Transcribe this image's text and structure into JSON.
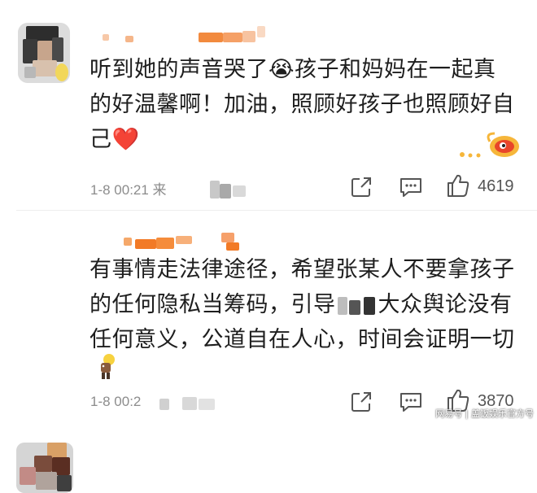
{
  "comments": [
    {
      "lines": [
        "听到她的声音哭了😭孩子和妈妈在一起真",
        "的好温馨啊！加油，照顾好孩子也照顾好自",
        "己❤️"
      ],
      "time": "1-8 00:21 来",
      "likes": "4619",
      "emoji_icon": "crying-face-icon",
      "heart_icon": "red-heart-icon",
      "badge_icon": "weibo-badge-icon"
    },
    {
      "lines": [
        "有事情走法律途径，希望张某人不要拿孩子",
        "的任何隐私当筹码，引导",
        "大众舆论没有",
        "任何意义，公道自在人心，时间会证明一切"
      ],
      "time": "1-8 00:2",
      "likes": "3870",
      "sticker_icon": "bulb-figure-icon"
    }
  ],
  "watermark": "网易号 | 盖饭娱乐官方号",
  "colors": {
    "text": "#1e1e1e",
    "meta": "#8c8c8c",
    "username_orange": "#f48b3c"
  }
}
